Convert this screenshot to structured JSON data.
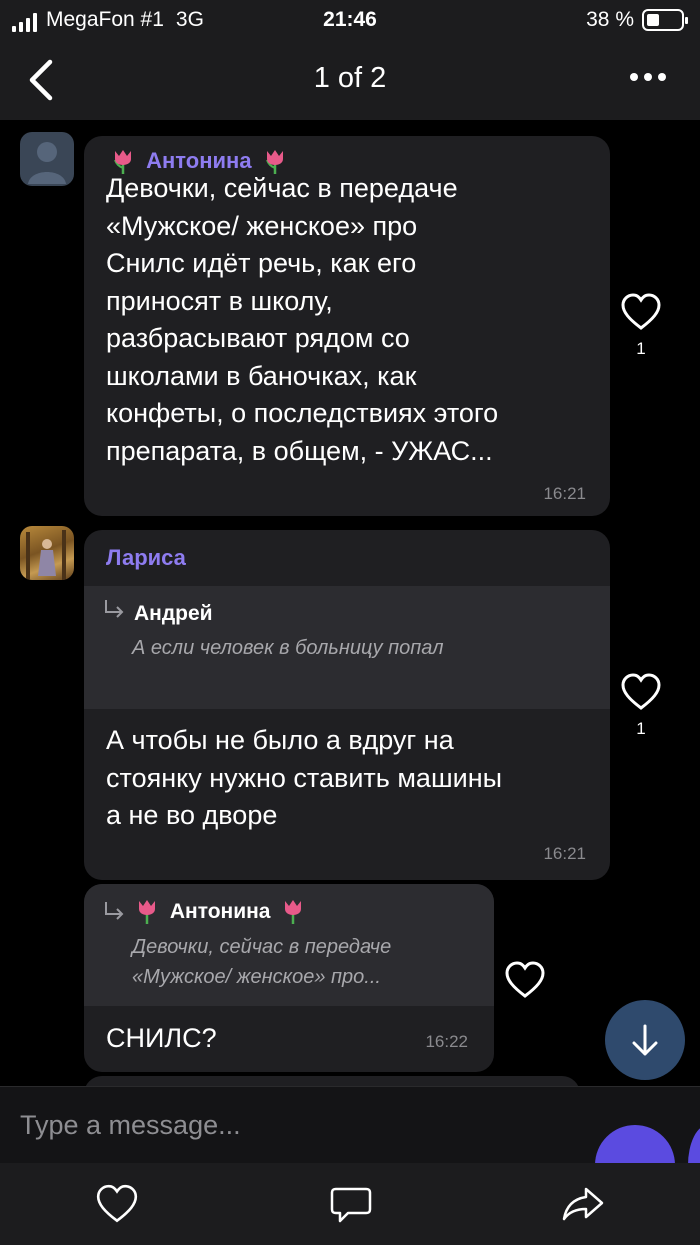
{
  "status": {
    "carrier": "MegaFon #1",
    "network": "3G",
    "time": "21:46",
    "battery_percent": "38 %",
    "battery_level": 0.38
  },
  "nav": {
    "title": "1 of 2"
  },
  "messages": [
    {
      "sender": "Антонина",
      "text": "Девочки, сейчас в передаче\n«Мужское/ женское» про\nСнилс идёт речь, как его\nприносят в школу,\nразбрасывают рядом со\nшколами в баночках, как\nконфеты, о последствиях этого\nпрепарата, в общем, - УЖАС...",
      "time": "16:21",
      "likes": "1"
    },
    {
      "sender": "Лариса",
      "reply_name": "Андрей",
      "reply_text": "А если человек в больницу попал",
      "text": "А чтобы не было а вдруг на\nстоянку нужно ставить машины\nа не во дворе",
      "time": "16:21",
      "likes": "1"
    },
    {
      "reply_name": "Антонина",
      "reply_text": "Девочки, сейчас в передаче\n«Мужское/ женское» про...",
      "text": "СНИЛС?",
      "time": "16:22"
    }
  ],
  "composer": {
    "placeholder": "Type a message..."
  },
  "colors": {
    "sender": "#8e7cf0",
    "bubble": "#1f1f22",
    "reply_bg": "#2c2c30",
    "fab": "#2f4a6d",
    "mic": "#5b4be0"
  }
}
